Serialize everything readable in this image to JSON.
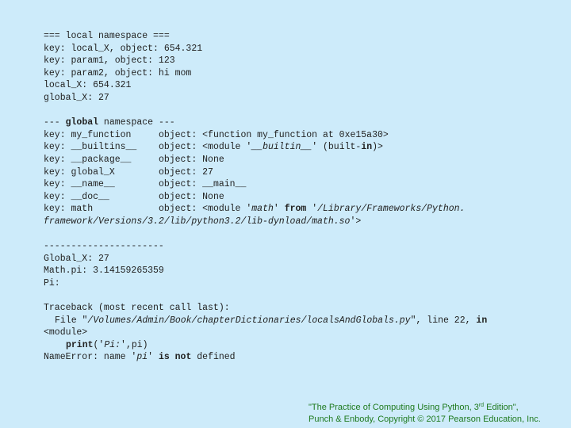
{
  "local_section": {
    "header": "=== local namespace ===",
    "lines": [
      "key: local_X, object: 654.321",
      "key: param1, object: 123",
      "key: param2, object: hi mom",
      "local_X: 654.321",
      "global_X: 27"
    ]
  },
  "global_section": {
    "header_prefix": "--- ",
    "header_keyword": "global",
    "header_suffix": " namespace ---",
    "rows": [
      {
        "key": "key: my_function     ",
        "obj": "object: <function my_function at 0xe15a30>"
      },
      {
        "key": "key: __builtins__    ",
        "obj_pre": "object: <module '",
        "obj_it": "__builtin__",
        "obj_mid": "' (built-",
        "obj_kw": "in",
        "obj_post": ")>"
      },
      {
        "key": "key: __package__     ",
        "obj": "object: None"
      },
      {
        "key": "key: global_X        ",
        "obj": "object: 27"
      },
      {
        "key": "key: __name__        ",
        "obj": "object: __main__"
      },
      {
        "key": "key: __doc__         ",
        "obj": "object: None"
      }
    ],
    "math_row": {
      "key": "key: math            ",
      "obj_pre": "object: <module '",
      "obj_it1": "math",
      "obj_mid1": "' ",
      "obj_kw": "from",
      "obj_mid2": " '",
      "obj_it2": "/Library/Frameworks/Python.",
      "cont_it": "framework/Versions/3.2/lib/python3.2/lib-dynload/math.so",
      "cont_post": "'>"
    }
  },
  "output_section": {
    "separator": "----------------------",
    "lines": [
      "Global_X: 27",
      "Math.pi: 3.14159265359",
      "Pi:"
    ]
  },
  "traceback": {
    "header": "Traceback (most recent call last):",
    "file_pre": "File \"",
    "file_path": "/Volumes/Admin/Book/chapterDictionaries/localsAndGlobals.py",
    "file_post": "\", line 22, ",
    "file_kw": "in",
    "module": "<module>",
    "code_kw": "print",
    "code_pre": "('",
    "code_it": "Pi:",
    "code_post": "',pi)",
    "error_pre": "NameError: name '",
    "error_it": "pi",
    "error_mid": "' ",
    "error_kw": "is not",
    "error_post": " defined"
  },
  "footer": {
    "line1_pre": "\"The Practice of Computing Using Python, 3",
    "line1_sup": "rd",
    "line1_post": " Edition\",",
    "line2": "Punch & Enbody, Copyright © 2017 Pearson Education, Inc."
  }
}
